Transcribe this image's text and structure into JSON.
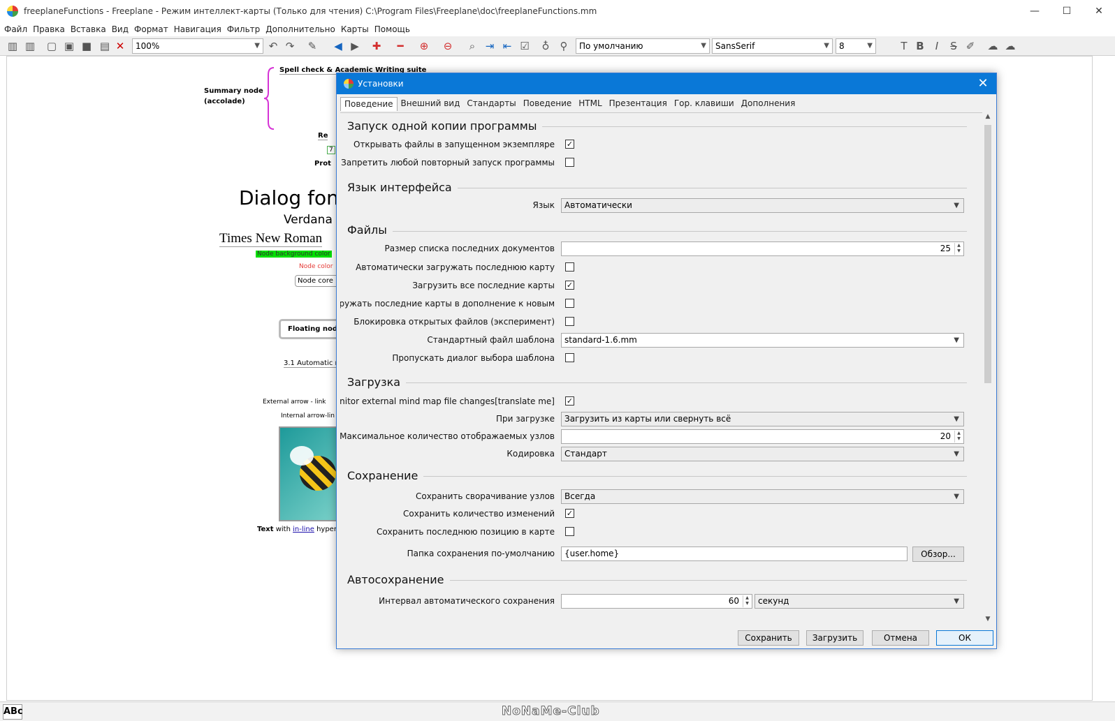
{
  "window": {
    "title": "freeplaneFunctions - Freeplane - Режим интеллект-карты (Только для чтения) C:\\Program Files\\Freeplane\\doc\\freeplaneFunctions.mm",
    "minimize": "—",
    "maximize": "☐",
    "close": "✕"
  },
  "menu": [
    "Файл",
    "Правка",
    "Вставка",
    "Вид",
    "Формат",
    "Навигация",
    "Фильтр",
    "Дополнительно",
    "Карты",
    "Помощь"
  ],
  "toolbar": {
    "zoom": "100%",
    "style": "По умолчанию",
    "font": "SansSerif",
    "size": "8"
  },
  "map": {
    "spell_check": "Spell check & Academic Writing suite",
    "summary": "Summary node",
    "summary2": "(accolade)",
    "re": "Re",
    "seven": "7",
    "prot": "Prot",
    "dialog_font": "Dialog font",
    "verdana": "Verdana",
    "times": "Times New Roman",
    "node_bg": "Node background color",
    "node_color": "Node color",
    "node_core": "Node core i",
    "floating": "Floating node",
    "auto": "3.1 Automatic no",
    "ext_arrow": "External arrow - link",
    "int_arrow": "Internal arrow-lin",
    "text_bold": "Text",
    "text_with": "with",
    "inline": "in-line",
    "hyper": "hyperl"
  },
  "status": {
    "abc": "ABc",
    "watermark": "NoNaMe-Club"
  },
  "dialog": {
    "title": "Установки",
    "close": "✕",
    "tabs": [
      "Поведение",
      "Внешний вид",
      "Стандарты",
      "Поведение",
      "HTML",
      "Презентация",
      "Гор. клавиши",
      "Дополнения"
    ],
    "sections": {
      "single": "Запуск одной копии программы",
      "lang": "Язык интерфейса",
      "files": "Файлы",
      "load": "Загрузка",
      "save": "Сохранение",
      "autosave": "Автосохранение"
    },
    "rows": {
      "open_in_running": "Открывать файлы в запущенном экземпляре",
      "forbid_restart": "Запретить любой повторный запуск программы",
      "language": "Язык",
      "language_value": "Автоматически",
      "recent_size": "Размер списка последних документов",
      "recent_size_value": "25",
      "auto_load_last": "Автоматически загружать последнюю карту",
      "load_all_last": "Загрузить все последние карты",
      "load_last_plus_new": "Загружать последние карты в дополнение к новым",
      "lock_files": "Блокировка открытых файлов (эксперимент)",
      "template": "Стандартный файл шаблона",
      "template_value": "standard-1.6.mm",
      "skip_template": "Пропускать диалог выбора шаблона",
      "monitor": "Monitor external mind map file changes[translate me]",
      "on_load": "При загрузке",
      "on_load_value": "Загрузить из карты или свернуть всё",
      "max_nodes": "Максимальное количество отображаемых узлов",
      "max_nodes_value": "20",
      "encoding": "Кодировка",
      "encoding_value": "Стандарт",
      "save_folding": "Сохранить сворачивание узлов",
      "save_folding_value": "Всегда",
      "save_changes": "Сохранить количество изменений",
      "save_position": "Сохранить последнюю позицию в карте",
      "save_folder": "Папка сохранения по-умолчанию",
      "save_folder_value": "{user.home}",
      "browse": "Обзор...",
      "autosave_interval": "Интервал автоматического сохранения",
      "autosave_interval_value": "60",
      "autosave_unit": "секунд"
    },
    "checks": {
      "open_in_running": true,
      "forbid_restart": false,
      "auto_load_last": false,
      "load_all_last": true,
      "load_last_plus_new": false,
      "lock_files": false,
      "skip_template": false,
      "monitor": true,
      "save_changes": true,
      "save_position": false
    },
    "buttons": {
      "save": "Сохранить",
      "load": "Загрузить",
      "cancel": "Отмена",
      "ok": "ОК"
    }
  }
}
